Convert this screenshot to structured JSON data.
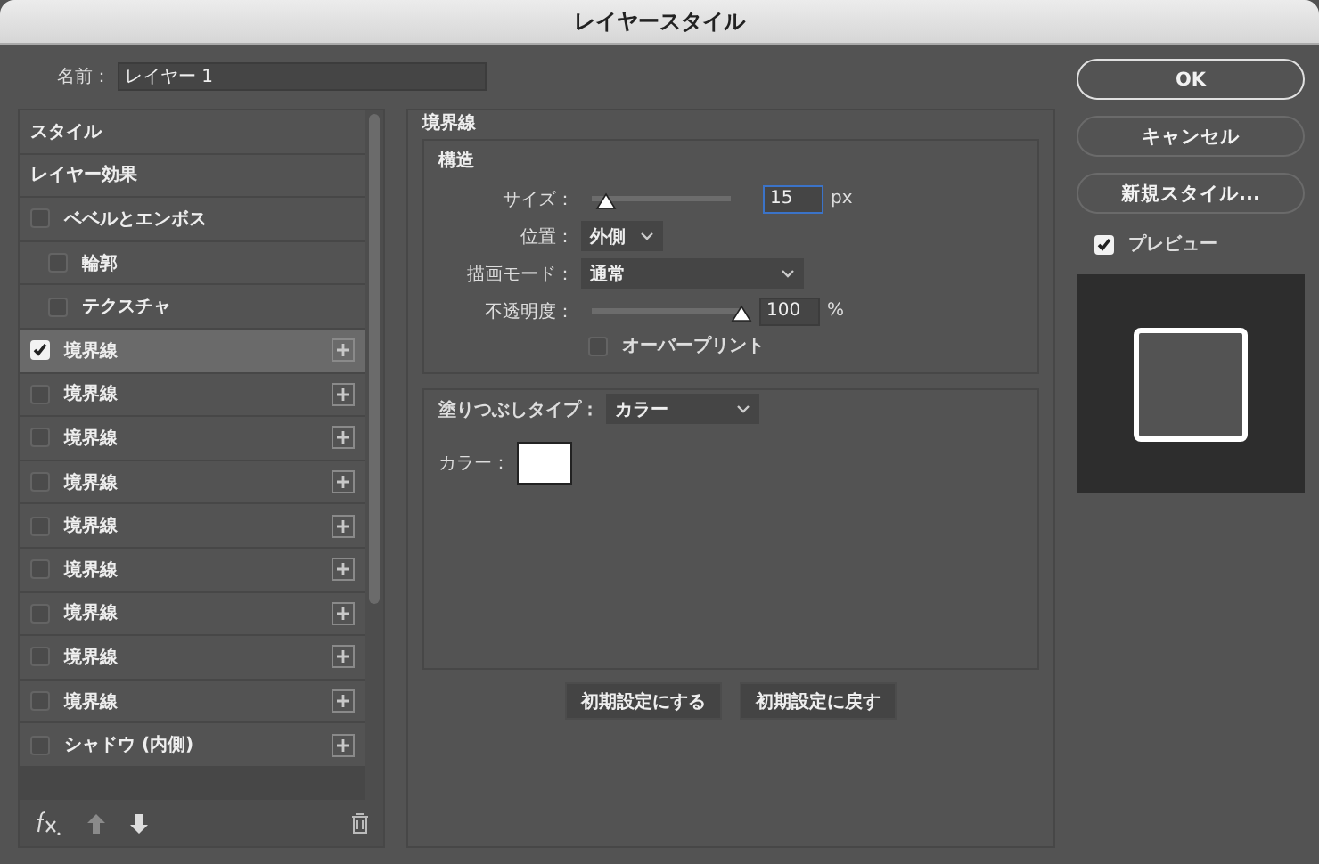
{
  "window": {
    "title": "レイヤースタイル"
  },
  "name_field": {
    "label": "名前：",
    "value": "レイヤー 1"
  },
  "effects": [
    {
      "kind": "header",
      "label": "スタイル",
      "selected": false
    },
    {
      "kind": "header",
      "label": "レイヤー効果",
      "selected": false
    },
    {
      "kind": "effect",
      "label": "ベベルとエンボス",
      "checked": false,
      "selected": false,
      "children": [
        {
          "kind": "effect",
          "label": "輪郭",
          "checked": false,
          "selected": false
        },
        {
          "kind": "effect",
          "label": "テクスチャ",
          "checked": false,
          "selected": false
        }
      ]
    },
    {
      "kind": "multi",
      "label": "境界線",
      "checked": true,
      "selected": true
    },
    {
      "kind": "multi",
      "label": "境界線",
      "checked": false,
      "selected": false
    },
    {
      "kind": "multi",
      "label": "境界線",
      "checked": false,
      "selected": false
    },
    {
      "kind": "multi",
      "label": "境界線",
      "checked": false,
      "selected": false
    },
    {
      "kind": "multi",
      "label": "境界線",
      "checked": false,
      "selected": false
    },
    {
      "kind": "multi",
      "label": "境界線",
      "checked": false,
      "selected": false
    },
    {
      "kind": "multi",
      "label": "境界線",
      "checked": false,
      "selected": false
    },
    {
      "kind": "multi",
      "label": "境界線",
      "checked": false,
      "selected": false
    },
    {
      "kind": "multi",
      "label": "境界線",
      "checked": false,
      "selected": false
    },
    {
      "kind": "multi",
      "label": "シャドウ (内側)",
      "checked": false,
      "selected": false
    }
  ],
  "panel": {
    "title": "境界線",
    "structure": {
      "title": "構造",
      "size": {
        "label": "サイズ：",
        "level": 0.1,
        "value": "15",
        "unit": "px"
      },
      "position": {
        "label": "位置：",
        "value": "外側"
      },
      "blend_mode": {
        "label": "描画モード：",
        "value": "通常"
      },
      "opacity": {
        "label": "不透明度：",
        "level": 1,
        "value": "100",
        "unit": "%"
      },
      "overprint": {
        "label": "オーバープリント",
        "checked": false
      }
    },
    "fill": {
      "label": "塗りつぶしタイプ：",
      "value": "カラー",
      "color_label": "カラー：",
      "color": "#ffffff"
    },
    "buttons": [
      "初期設定にする",
      "初期設定に戻す"
    ]
  },
  "actions": [
    {
      "label": "OK",
      "primary": true
    },
    {
      "label": "キャンセル",
      "primary": false
    },
    {
      "label": "新規スタイル...",
      "primary": false
    }
  ],
  "preview": {
    "label": "プレビュー",
    "checked": true
  }
}
